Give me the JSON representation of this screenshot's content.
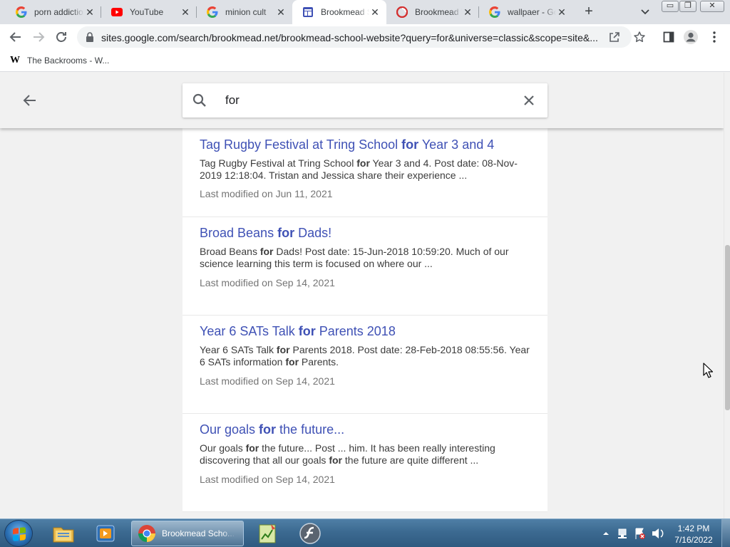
{
  "browser": {
    "tabs": [
      {
        "title": "porn addiction",
        "favicon": "google-icon",
        "active": false
      },
      {
        "title": "YouTube",
        "favicon": "youtube-icon",
        "active": false
      },
      {
        "title": "minion cult",
        "favicon": "google-icon",
        "active": false
      },
      {
        "title": "Brookmead School",
        "favicon": "google-sites-icon",
        "active": true
      },
      {
        "title": "Brookmead Village",
        "favicon": "brookmead-icon",
        "active": false
      },
      {
        "title": "wallpaer - Google",
        "favicon": "google-icon",
        "active": false
      }
    ],
    "url": "sites.google.com/search/brookmead.net/brookmead-school-website?query=for&universe=classic&scope=site&...",
    "bookmarks": [
      {
        "label": "The Backrooms - W...",
        "icon": "wikipedia-icon",
        "logo": "W"
      }
    ],
    "window_controls": {
      "minimize": "▭",
      "restore": "❐",
      "close": "✕"
    }
  },
  "search": {
    "query": "for",
    "placeholder": ""
  },
  "results": [
    {
      "title_parts": [
        {
          "t": "Tag Rugby Festival at Tring School ",
          "b": false
        },
        {
          "t": "for",
          "b": true
        },
        {
          "t": " Year 3 and 4",
          "b": false
        }
      ],
      "snippet_parts": [
        {
          "t": "Tag Rugby Festival at Tring School ",
          "b": false
        },
        {
          "t": "for",
          "b": true
        },
        {
          "t": " Year 3 and 4. Post date: 08-Nov-2019 12:18:04. Tristan and Jessica share their experience ...",
          "b": false
        }
      ],
      "modified": "Last modified on Jun 11, 2021"
    },
    {
      "title_parts": [
        {
          "t": "Broad Beans ",
          "b": false
        },
        {
          "t": "for",
          "b": true
        },
        {
          "t": " Dads!",
          "b": false
        }
      ],
      "snippet_parts": [
        {
          "t": "Broad Beans ",
          "b": false
        },
        {
          "t": "for",
          "b": true
        },
        {
          "t": " Dads! Post date: 15-Jun-2018 10:59:20. Much of our science learning this term is focused on where our ...",
          "b": false
        }
      ],
      "modified": "Last modified on Sep 14, 2021"
    },
    {
      "title_parts": [
        {
          "t": "Year 6 SATs Talk ",
          "b": false
        },
        {
          "t": "for",
          "b": true
        },
        {
          "t": " Parents 2018",
          "b": false
        }
      ],
      "snippet_parts": [
        {
          "t": "Year 6 SATs Talk ",
          "b": false
        },
        {
          "t": "for",
          "b": true
        },
        {
          "t": " Parents 2018. Post date: 28-Feb-2018 08:55:56. Year 6 SATs information ",
          "b": false
        },
        {
          "t": "for",
          "b": true
        },
        {
          "t": " Parents.",
          "b": false
        }
      ],
      "modified": "Last modified on Sep 14, 2021"
    },
    {
      "title_parts": [
        {
          "t": "Our goals ",
          "b": false
        },
        {
          "t": "for",
          "b": true
        },
        {
          "t": " the future...",
          "b": false
        }
      ],
      "snippet_parts": [
        {
          "t": "Our goals ",
          "b": false
        },
        {
          "t": "for",
          "b": true
        },
        {
          "t": " the future... Post ... him. It has been really interesting discovering that all our goals ",
          "b": false
        },
        {
          "t": "for",
          "b": true
        },
        {
          "t": " the future are quite different ...",
          "b": false
        }
      ],
      "modified": "Last modified on Sep 14, 2021"
    }
  ],
  "taskbar": {
    "active_window_label": "Brookmead Scho...",
    "clock_time": "1:42 PM",
    "clock_date": "7/16/2022"
  },
  "colors": {
    "result_title": "#3f51b5",
    "page_background": "#f1f1f1",
    "taskbar": "#3c6a91"
  }
}
